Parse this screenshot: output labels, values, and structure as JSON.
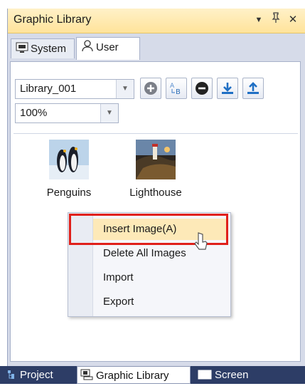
{
  "panel": {
    "title": "Graphic Library",
    "controls": {
      "dropdown": "▼",
      "pin": "📌",
      "close": "✕"
    }
  },
  "tabs": [
    {
      "label": "System",
      "icon": "system-icon",
      "active": false
    },
    {
      "label": "User",
      "icon": "user-icon",
      "active": true
    }
  ],
  "toolbar": {
    "library_value": "Library_001",
    "zoom_value": "100%",
    "buttons": [
      {
        "name": "add-library-button",
        "icon": "plus-circle-icon"
      },
      {
        "name": "rename-library-button",
        "icon": "rename-ab-icon"
      },
      {
        "name": "remove-library-button",
        "icon": "minus-circle-icon"
      },
      {
        "name": "import-library-button",
        "icon": "download-icon"
      },
      {
        "name": "export-library-button",
        "icon": "upload-icon"
      }
    ]
  },
  "images": [
    {
      "label": "Penguins"
    },
    {
      "label": "Lighthouse"
    }
  ],
  "context_menu": {
    "items": [
      {
        "label": "Insert Image(A)",
        "highlighted": true
      },
      {
        "label": "Delete All Images",
        "highlighted": false
      },
      {
        "label": "Import",
        "highlighted": false
      },
      {
        "label": "Export",
        "highlighted": false
      }
    ]
  },
  "bottom_tabs": [
    {
      "label": "Project",
      "icon": "project-icon",
      "active": false
    },
    {
      "label": "Graphic Library",
      "icon": "graphic-library-icon",
      "active": true
    },
    {
      "label": "Screen",
      "icon": "screen-icon",
      "active": false
    }
  ],
  "colors": {
    "accent_highlight": "#fde9b8",
    "annotation_red": "#e0201a",
    "titlebar": "#ffe39a",
    "bottombar": "#2d3d66"
  }
}
